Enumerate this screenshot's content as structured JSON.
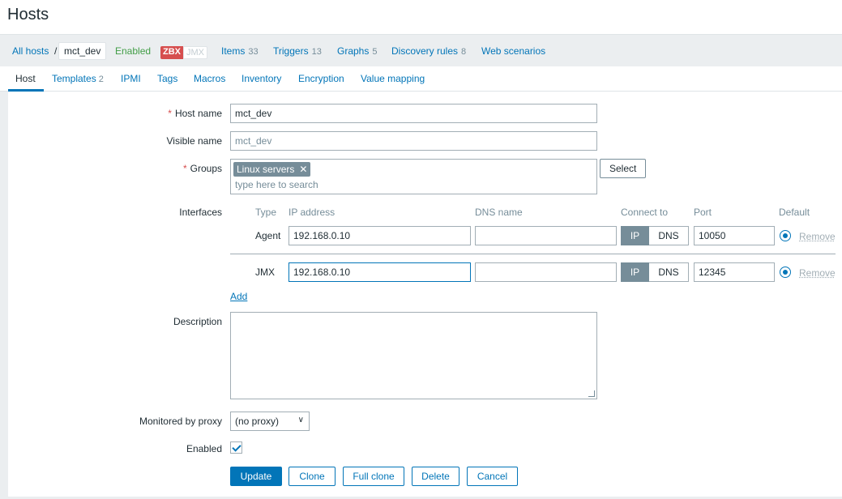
{
  "page": {
    "title": "Hosts"
  },
  "nav": {
    "all_hosts": "All hosts",
    "separator": "/",
    "current_host": "mct_dev",
    "status": "Enabled",
    "zbx_badge": "ZBX",
    "jmx_badge": "JMX",
    "items": {
      "label": "Items",
      "count": "33"
    },
    "triggers": {
      "label": "Triggers",
      "count": "13"
    },
    "graphs": {
      "label": "Graphs",
      "count": "5"
    },
    "discovery_rules": {
      "label": "Discovery rules",
      "count": "8"
    },
    "web_scenarios": {
      "label": "Web scenarios"
    }
  },
  "tabs": [
    {
      "label": "Host",
      "count": ""
    },
    {
      "label": "Templates",
      "count": "2"
    },
    {
      "label": "IPMI",
      "count": ""
    },
    {
      "label": "Tags",
      "count": ""
    },
    {
      "label": "Macros",
      "count": ""
    },
    {
      "label": "Inventory",
      "count": ""
    },
    {
      "label": "Encryption",
      "count": ""
    },
    {
      "label": "Value mapping",
      "count": ""
    }
  ],
  "form": {
    "required_mark": "*",
    "host_name": {
      "label": "Host name",
      "value": "mct_dev"
    },
    "visible_name": {
      "label": "Visible name",
      "placeholder": "mct_dev"
    },
    "groups": {
      "label": "Groups",
      "chips": [
        "Linux servers"
      ],
      "chip_remove": "✕",
      "search_placeholder": "type here to search",
      "select_button": "Select"
    },
    "interfaces": {
      "label": "Interfaces",
      "columns": {
        "type": "Type",
        "ip": "IP address",
        "dns": "DNS name",
        "connect": "Connect to",
        "port": "Port",
        "default": "Default"
      },
      "rows": [
        {
          "type": "Agent",
          "ip": "192.168.0.10",
          "dns": "",
          "connect_ip": "IP",
          "connect_dns": "DNS",
          "port": "10050",
          "remove": "Remove"
        },
        {
          "type": "JMX",
          "ip": "192.168.0.10",
          "dns": "",
          "connect_ip": "IP",
          "connect_dns": "DNS",
          "port": "12345",
          "remove": "Remove"
        }
      ],
      "add_link": "Add"
    },
    "description": {
      "label": "Description",
      "value": ""
    },
    "proxy": {
      "label": "Monitored by proxy",
      "value": "(no proxy)"
    },
    "enabled": {
      "label": "Enabled",
      "checked": true
    }
  },
  "actions": {
    "update": "Update",
    "clone": "Clone",
    "full_clone": "Full clone",
    "delete": "Delete",
    "cancel": "Cancel"
  },
  "colors": {
    "accent": "#0275b8",
    "danger": "#d64e4e",
    "ok": "#429e47",
    "muted": "#768d99"
  }
}
